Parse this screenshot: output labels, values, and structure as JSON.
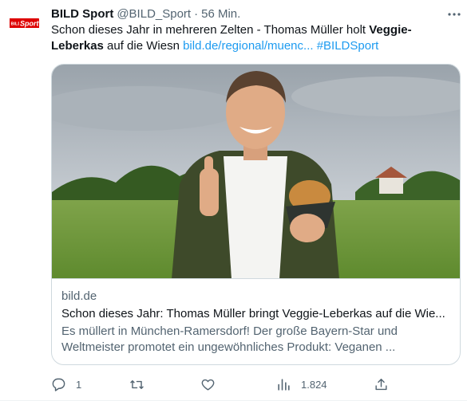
{
  "author": {
    "avatar_label": "BILD Sport",
    "display_name": "BILD Sport",
    "handle": "@BILD_Sport",
    "separator": "·",
    "time": "56 Min."
  },
  "tweet": {
    "text_part1": "Schon dieses Jahr in mehreren Zelten - Thomas Müller holt ",
    "text_bold": "Veggie-Leberkas",
    "text_part2": " auf die Wiesn ",
    "link": "bild.de/regional/muenc...",
    "hashtag": "#BILDSport"
  },
  "card": {
    "domain": "bild.de",
    "title": "Schon dieses Jahr: Thomas Müller bringt Veggie-Leberkas auf die Wie...",
    "description": "Es müllert in München-Ramersdorf! Der große Bayern-Star und Weltmeister promotet ein ungewöhnliches Produkt: Veganen ..."
  },
  "actions": {
    "replies": "1",
    "retweets": "",
    "likes": "",
    "views": "1.824"
  },
  "icons": {
    "reply": "reply-icon",
    "retweet": "retweet-icon",
    "like": "heart-icon",
    "views": "views-icon",
    "share": "share-icon",
    "more": "more-icon"
  },
  "colors": {
    "brand_red": "#dd0000",
    "link_blue": "#1d9bf0",
    "secondary_text": "#536471",
    "border": "#cfd9de"
  }
}
